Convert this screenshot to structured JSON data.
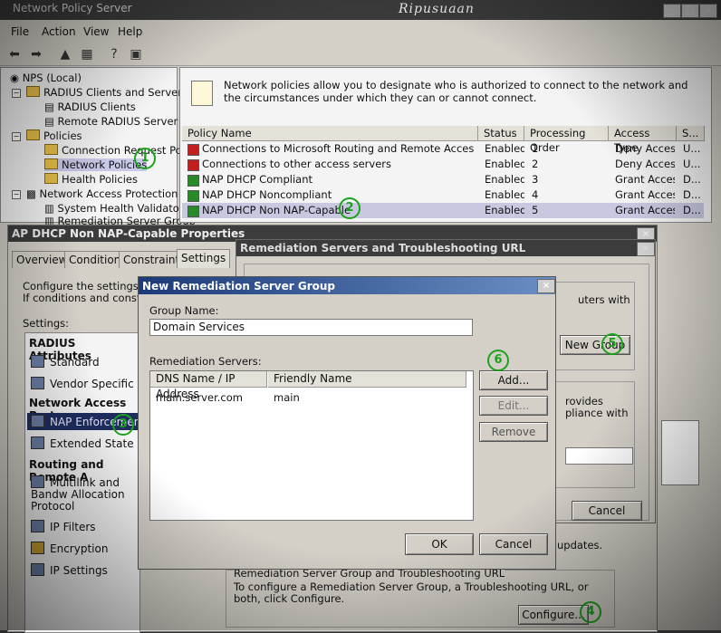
{
  "window": {
    "title": "Network Policy Server",
    "watermark": "Ripusuaan",
    "menu": [
      "File",
      "Action",
      "View",
      "Help"
    ]
  },
  "tree": {
    "items": [
      {
        "label": "NPS (Local)"
      },
      {
        "label": "RADIUS Clients and Servers"
      },
      {
        "label": "RADIUS Clients"
      },
      {
        "label": "Remote RADIUS Server G"
      },
      {
        "label": "Policies"
      },
      {
        "label": "Connection Request Polici"
      },
      {
        "label": "Network Policies"
      },
      {
        "label": "Health Policies"
      },
      {
        "label": "Network Access Protection"
      },
      {
        "label": "System Health Validators"
      },
      {
        "label": "Remediation Server Group"
      }
    ]
  },
  "policies": {
    "description": "Network policies allow you to designate who is authorized to connect to the network and the circumstances under which they can or cannot connect.",
    "columns": [
      "Policy Name",
      "Status",
      "Processing Order",
      "Access Type",
      "S..."
    ],
    "rows": [
      {
        "name": "Connections to Microsoft Routing and Remote Access server",
        "status": "Enabled",
        "order": "1",
        "access": "Deny Access",
        "source": "U...",
        "icon": "deny"
      },
      {
        "name": "Connections to other access servers",
        "status": "Enabled",
        "order": "2",
        "access": "Deny Access",
        "source": "U...",
        "icon": "deny"
      },
      {
        "name": "NAP DHCP Compliant",
        "status": "Enabled",
        "order": "3",
        "access": "Grant Access",
        "source": "D...",
        "icon": "grant"
      },
      {
        "name": "NAP DHCP Noncompliant",
        "status": "Enabled",
        "order": "4",
        "access": "Grant Access",
        "source": "D...",
        "icon": "grant"
      },
      {
        "name": "NAP DHCP Non NAP-Capable",
        "status": "Enabled",
        "order": "5",
        "access": "Grant Access",
        "source": "D...",
        "icon": "grant"
      }
    ]
  },
  "properties": {
    "title": "AP DHCP Non NAP-Capable Properties",
    "tabs": [
      "Overview",
      "Conditions",
      "Constraints",
      "Settings"
    ],
    "intro_line1": "Configure the settings for th",
    "intro_line2": "If conditions and constraint",
    "settings_label": "Settings:",
    "groups": [
      {
        "header": "RADIUS Attributes",
        "items": [
          "Standard",
          "Vendor Specific"
        ]
      },
      {
        "header": "Network Access Prote",
        "items": [
          "NAP Enforcement",
          "Extended State"
        ]
      },
      {
        "header": "Routing and Remote A",
        "items": [
          "Multilink and Bandw Allocation Protocol",
          "IP Filters",
          "Encryption",
          "IP Settings"
        ]
      }
    ],
    "bottom_text": "updates.",
    "rem_section_title": "Remediation Server Group and Troubleshooting URL",
    "rem_section_text": "To configure a Remediation Server Group, a Troubleshooting URL, or both, click Configure.",
    "configure_label": "Configure..."
  },
  "remediation_dialog": {
    "title": "Remediation Servers and Troubleshooting URL",
    "text1_a": "uters with",
    "text2_a": "rovides",
    "text2_b": "pliance with",
    "new_group_label": "New Group",
    "cancel_label": "Cancel"
  },
  "new_group_dialog": {
    "title": "New Remediation Server Group",
    "group_name_label": "Group Name:",
    "group_name_value": "Domain Services",
    "servers_label": "Remediation Servers:",
    "columns": [
      "DNS Name / IP Address",
      "Friendly Name"
    ],
    "rows": [
      {
        "dns": "main.server.com",
        "friendly": "main"
      }
    ],
    "add_label": "Add...",
    "edit_label": "Edit...",
    "remove_label": "Remove",
    "ok_label": "OK",
    "cancel_label": "Cancel"
  },
  "callouts": [
    "1",
    "2",
    "3",
    "4",
    "5",
    "6"
  ],
  "colors": {
    "callout": "#1aa31a",
    "deny": "#c02020",
    "grant": "#2a8a2a"
  }
}
